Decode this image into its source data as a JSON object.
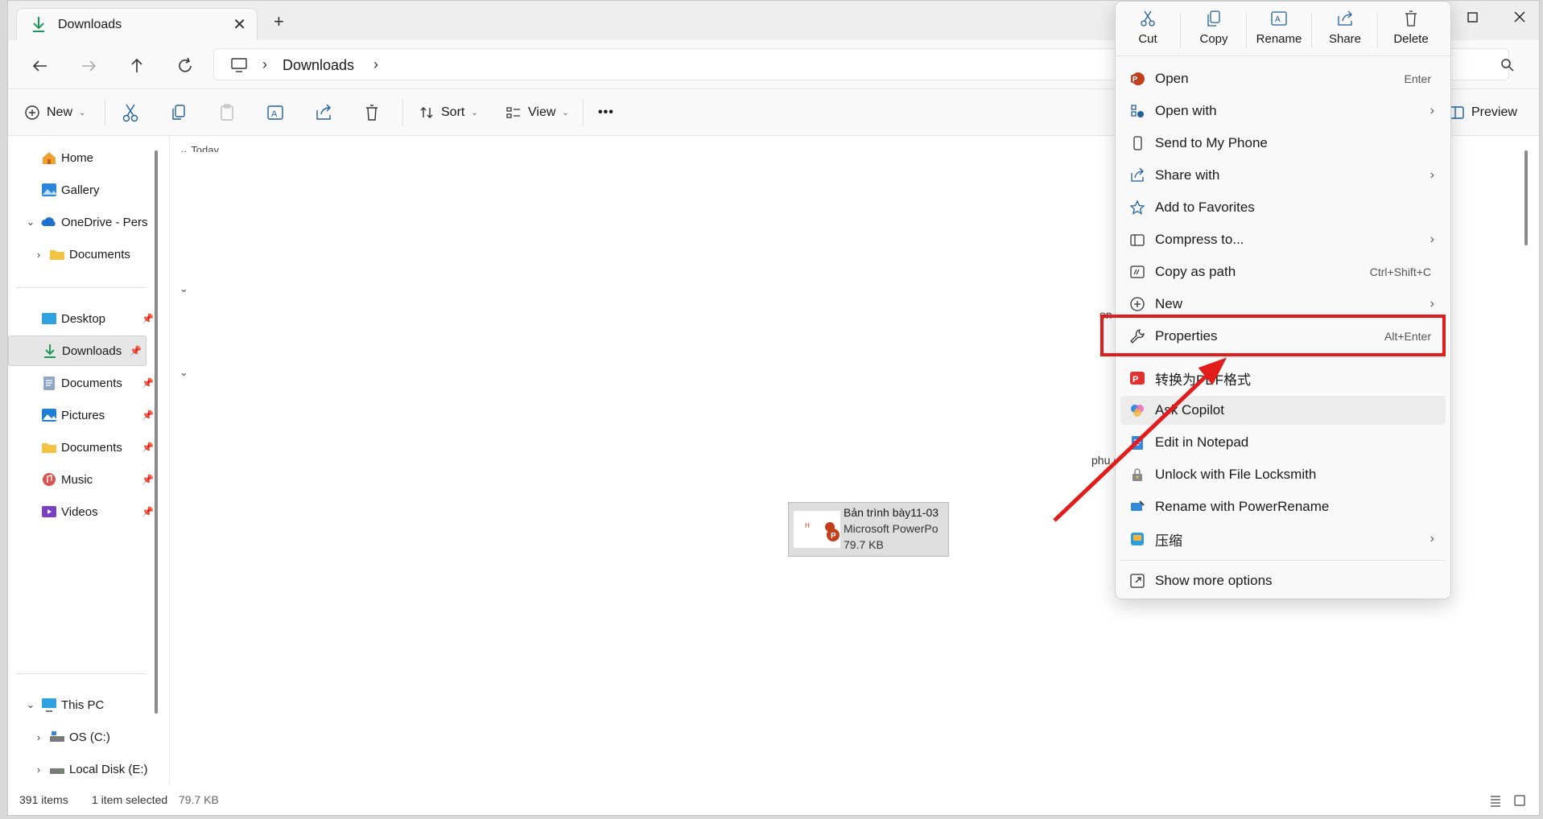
{
  "window": {
    "tab_title": "Downloads",
    "tab_close": "✕",
    "new_tab": "+"
  },
  "address": {
    "separator": "›",
    "crumb": "Downloads"
  },
  "commandbar": {
    "new_label": "New",
    "sort_label": "Sort",
    "view_label": "View",
    "more_label": "•••",
    "preview_label": "Preview"
  },
  "sidebar": {
    "items": [
      {
        "label": "Home"
      },
      {
        "label": "Gallery"
      },
      {
        "label": "OneDrive - Perso"
      },
      {
        "label": "Documents"
      },
      {
        "label": "Desktop"
      },
      {
        "label": "Downloads"
      },
      {
        "label": "Documents"
      },
      {
        "label": "Pictures"
      },
      {
        "label": "Documents"
      },
      {
        "label": "Music"
      },
      {
        "label": "Videos"
      },
      {
        "label": "This PC"
      },
      {
        "label": "OS (C:)"
      },
      {
        "label": "Local Disk (E:)"
      }
    ],
    "pin": "📌"
  },
  "main": {
    "group_today": "Today",
    "fragment_1": "on",
    "fragment_2": "phu (",
    "file": {
      "name": "Bản trình bày11-03",
      "type": "Microsoft PowerPo",
      "size": "79.7 KB"
    }
  },
  "status": {
    "items": "391 items",
    "selected": "1 item selected",
    "selected_size": "79.7 KB"
  },
  "context_menu": {
    "quick_actions": [
      {
        "label": "Cut",
        "icon": "cut-icon"
      },
      {
        "label": "Copy",
        "icon": "copy-icon"
      },
      {
        "label": "Rename",
        "icon": "rename-icon"
      },
      {
        "label": "Share",
        "icon": "share-icon"
      },
      {
        "label": "Delete",
        "icon": "delete-icon"
      }
    ],
    "items": [
      {
        "label": "Open",
        "accel": "Enter",
        "icon": "powerpoint-icon"
      },
      {
        "label": "Open with",
        "icon": "open-with-icon",
        "submenu": true
      },
      {
        "label": "Send to My Phone",
        "icon": "phone-icon"
      },
      {
        "label": "Share with",
        "icon": "share-icon",
        "submenu": true
      },
      {
        "label": "Add to Favorites",
        "icon": "star-icon"
      },
      {
        "label": "Compress to...",
        "icon": "archive-icon",
        "submenu": true
      },
      {
        "label": "Copy as path",
        "accel": "Ctrl+Shift+C",
        "icon": "path-icon"
      },
      {
        "label": "New",
        "icon": "plus-circle-icon",
        "submenu": true
      },
      {
        "label": "Properties",
        "accel": "Alt+Enter",
        "icon": "wrench-icon"
      },
      {
        "label": "转换为PDF格式",
        "icon": "pdf-convert-icon"
      },
      {
        "label": "Ask Copilot",
        "icon": "copilot-icon"
      },
      {
        "label": "Edit in Notepad",
        "icon": "notepad-icon"
      },
      {
        "label": "Unlock with File Locksmith",
        "icon": "lock-icon"
      },
      {
        "label": "Rename with PowerRename",
        "icon": "powerrename-icon"
      },
      {
        "label": "压缩",
        "icon": "zip-icon",
        "submenu": true
      },
      {
        "label": "Show more options",
        "icon": "more-options-icon"
      }
    ],
    "submenu_arrow": "›"
  },
  "colors": {
    "annotation": "#e21b1b",
    "accent": "#0f6cbd",
    "powerpoint": "#c43e1c"
  }
}
